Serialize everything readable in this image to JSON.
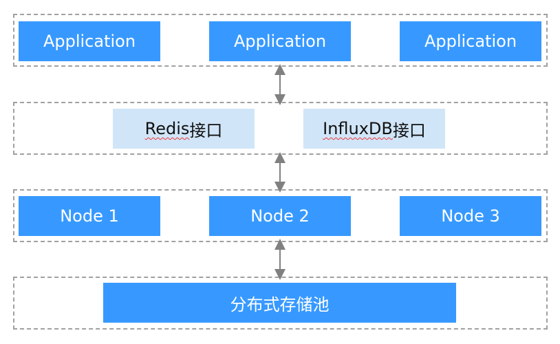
{
  "colors": {
    "primary": "#3799ff",
    "interface": "#d0e5f8",
    "border": "#a0a0a0",
    "arrow": "#808080"
  },
  "applications": [
    "Application",
    "Application",
    "Application"
  ],
  "interfaces": [
    {
      "name": "Redis",
      "suffix": "接口"
    },
    {
      "name": "InfluxDB",
      "suffix": "接口"
    }
  ],
  "nodes": [
    "Node 1",
    "Node 2",
    "Node 3"
  ],
  "storage": "分布式存储池"
}
